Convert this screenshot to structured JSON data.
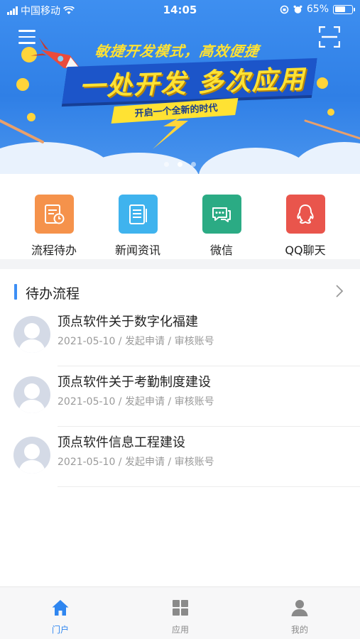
{
  "status_bar": {
    "carrier": "中国移动",
    "time": "14:05",
    "battery": "65%",
    "battery_level": 0.65
  },
  "banner": {
    "subtitle": "敏捷开发模式，高效便捷",
    "headline": "一处开发 多次应用",
    "tagline": "开启一个全新的时代",
    "slide_count": 3,
    "active_slide": 2,
    "colors": {
      "background": "#3a8aee",
      "accent": "#ffe233"
    }
  },
  "quick_entries": [
    {
      "label": "流程待办",
      "icon": "process-todo-icon",
      "color": "#f5924b"
    },
    {
      "label": "新闻资讯",
      "icon": "news-icon",
      "color": "#3fb3ee"
    },
    {
      "label": "微信",
      "icon": "wechat-icon",
      "color": "#2bab84"
    },
    {
      "label": "QQ聊天",
      "icon": "qq-icon",
      "color": "#e9554c"
    }
  ],
  "todo": {
    "section_title": "待办流程",
    "items": [
      {
        "title": "顶点软件关于数字化福建",
        "meta": "2021-05-10 / 发起申请 / 审核账号"
      },
      {
        "title": "顶点软件关于考勤制度建设",
        "meta": "2021-05-10 / 发起申请 / 审核账号"
      },
      {
        "title": "顶点软件信息工程建设",
        "meta": "2021-05-10 / 发起申请 / 审核账号"
      }
    ]
  },
  "tabbar": {
    "items": [
      {
        "label": "门户",
        "icon": "home-icon",
        "active": true
      },
      {
        "label": "应用",
        "icon": "grid-icon",
        "active": false
      },
      {
        "label": "我的",
        "icon": "user-icon",
        "active": false
      }
    ],
    "active_color": "#2f86f0"
  }
}
